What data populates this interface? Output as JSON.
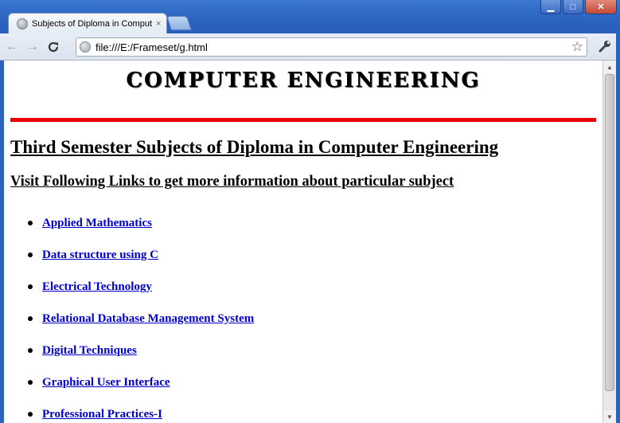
{
  "browser": {
    "tab": {
      "title": "Subjects of Diploma in Comput",
      "close_glyph": "×"
    },
    "window_controls": {
      "minimize": "▁",
      "maximize": "□",
      "close": "✕"
    },
    "address_bar": {
      "url": "file:///E:/Frameset/g.html"
    },
    "nav": {
      "back": "←",
      "forward": "→",
      "reload": "C"
    },
    "star": "☆",
    "wrench": "🔧"
  },
  "page": {
    "heading": "COMPUTER ENGINEERING",
    "rule_color": "#ee0000",
    "title": "Third Semester Subjects of Diploma in Computer Engineering",
    "subtitle": "Visit Following Links to get more information about particular subject",
    "subjects": [
      "Applied Mathematics",
      "Data structure using C",
      "Electrical Technology",
      "Relational Database Management System",
      "Digital Techniques",
      "Graphical User Interface",
      "Professional Practices-I"
    ],
    "link_color": "#0000cc"
  }
}
